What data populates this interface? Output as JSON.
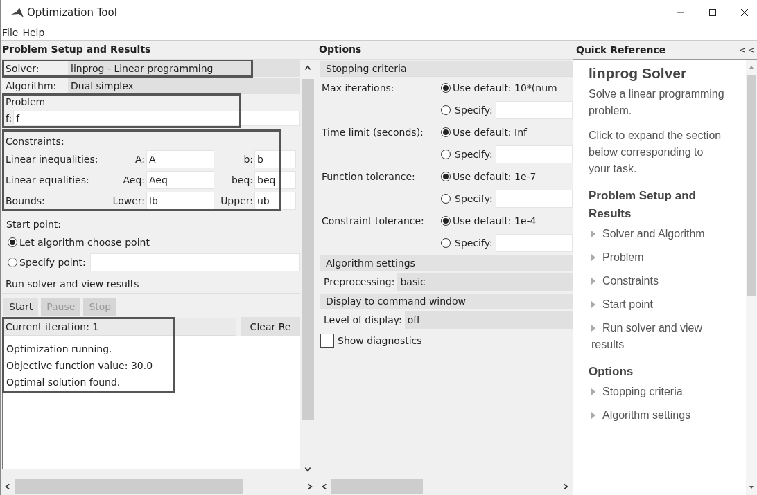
{
  "window": {
    "title": "Optimization Tool"
  },
  "menu": [
    {
      "label": "File"
    },
    {
      "label": "Help"
    }
  ],
  "problem_panel": {
    "title": "Problem Setup and Results",
    "solver": {
      "label": "Solver:",
      "value": "linprog - Linear programming",
      "highlighted": true
    },
    "algorithm": {
      "label": "Algorithm:",
      "value": "Dual simplex",
      "highlighted": false
    },
    "problem": {
      "title": "Problem",
      "f_label": "f:",
      "f_value": "f",
      "highlighted": true
    },
    "constraints": {
      "title": "Constraints:",
      "highlighted": true,
      "rows": [
        {
          "label": "Linear inequalities:",
          "a_label": "A:",
          "a_value": "A",
          "b_label": "b:",
          "b_value": "b"
        },
        {
          "label": "Linear equalities:",
          "a_label": "Aeq:",
          "a_value": "Aeq",
          "b_label": "beq:",
          "b_value": "beq"
        },
        {
          "label": "Bounds:",
          "a_label": "Lower:",
          "a_value": "lb",
          "b_label": "Upper:",
          "b_value": "ub"
        }
      ]
    },
    "start_point": {
      "title": "Start point:",
      "options": [
        {
          "label": "Let algorithm choose point",
          "selected": true,
          "has_field": false
        },
        {
          "label": "Specify point:",
          "selected": false,
          "has_field": true
        }
      ]
    },
    "run": {
      "title": "Run solver and view results",
      "buttons": [
        {
          "label": "Start",
          "disabled": false
        },
        {
          "label": "Pause",
          "disabled": true
        },
        {
          "label": "Stop",
          "disabled": true
        }
      ],
      "iteration": "Current iteration: 1",
      "clear_button": "Clear Re",
      "highlighted": true,
      "output": [
        "Optimization running.",
        "Objective function value: 30.0",
        "Optimal solution found."
      ]
    }
  },
  "options_panel": {
    "title": "Options",
    "sections": [
      {
        "title": "Stopping criteria",
        "rows": [
          {
            "kind": "radio_pair",
            "label": "Max iterations:",
            "default_label": "Use default: 10*(num",
            "default_selected": true,
            "specify_label": "Specify:",
            "specify_selected": false
          },
          {
            "kind": "radio_pair",
            "label": "Time limit (seconds):",
            "default_label": "Use default: Inf",
            "default_selected": true,
            "specify_label": "Specify:",
            "specify_selected": false
          },
          {
            "kind": "radio_pair",
            "label": "Function tolerance:",
            "default_label": "Use default: 1e-7",
            "default_selected": true,
            "specify_label": "Specify:",
            "specify_selected": false
          },
          {
            "kind": "radio_pair",
            "label": "Constraint tolerance:",
            "default_label": "Use default: 1e-4",
            "default_selected": true,
            "specify_label": "Specify:",
            "specify_selected": false
          }
        ]
      },
      {
        "title": "Algorithm settings",
        "rows": [
          {
            "kind": "dropdown",
            "label": "Preprocessing:",
            "value": "basic"
          }
        ]
      },
      {
        "title": "Display to command window",
        "rows": [
          {
            "kind": "dropdown",
            "label": "Level of display:",
            "value": "off"
          },
          {
            "kind": "checkbox",
            "label": "Show diagnostics",
            "checked": false
          }
        ]
      }
    ]
  },
  "quick_reference": {
    "title": "Quick Reference",
    "collapse_label": "< <",
    "heading": "linprog Solver",
    "paragraphs": [
      "Solve a linear programming problem.",
      "Click to expand the section below corresponding to your task."
    ],
    "sections": [
      {
        "title": "Problem Setup and Results",
        "items": [
          "Solver and Algorithm",
          "Problem",
          "Constraints",
          "Start point",
          "Run solver and view results"
        ]
      },
      {
        "title": "Options",
        "items": [
          "Stopping criteria",
          "Algorithm settings"
        ]
      }
    ]
  }
}
